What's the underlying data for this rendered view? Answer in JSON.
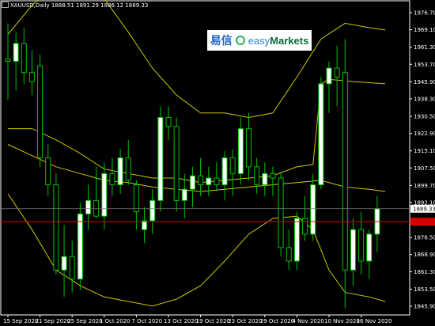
{
  "window": {
    "header_text": "XAUUSD,Daily  1888.51 1891.29 1886.12 1889.33"
  },
  "logo": {
    "cn_text": "易信",
    "en_text_a": "easy",
    "en_text_b": "Markets",
    "mark_icon": "easy-markets-swirl-icon"
  },
  "colors": {
    "background": "#000000",
    "bull_body": "#ffffff",
    "bear_body": "#000000",
    "candle_outline": "#00c000",
    "band": "#c8c800",
    "bid_line": "#ffffff",
    "ask_line": "#d40000"
  },
  "chart_data": {
    "type": "candlestick",
    "symbol": "XAUUSD",
    "timeframe": "Daily",
    "ohlc_header": {
      "open": 1888.51,
      "high": 1891.29,
      "low": 1886.12,
      "close": 1889.33
    },
    "y_range": [
      1842,
      1982
    ],
    "y_ticks": [
      "1976.70",
      "1969.10",
      "1961.30",
      "1953.70",
      "1945.90",
      "1938.30",
      "1930.50",
      "1922.90",
      "1915.10",
      "1907.50",
      "1899.70",
      "1892.10",
      "1876.50",
      "1868.90",
      "1861.30",
      "1853.50",
      "1845.90"
    ],
    "current_price_label": "1889.33",
    "current_price": 1889.33,
    "ask_price": 1883.6,
    "x_labels": [
      "15 Sep 2020",
      "21 Sep 2020",
      "25 Sep 2020",
      "1 Oct 2020",
      "7 Oct 2020",
      "13 Oct 2020",
      "19 Oct 2020",
      "23 Oct 2020",
      "29 Oct 2020",
      "4 Nov 2020",
      "10 Nov 2020",
      "16 Nov 2020"
    ],
    "x_label_bar_index": [
      0,
      4,
      8,
      12,
      16,
      20,
      24,
      28,
      32,
      36,
      40,
      44
    ],
    "candles": [
      {
        "o": 1956,
        "h": 1972,
        "l": 1938,
        "c": 1955
      },
      {
        "o": 1955,
        "h": 1968,
        "l": 1942,
        "c": 1963
      },
      {
        "o": 1963,
        "h": 1970,
        "l": 1945,
        "c": 1950
      },
      {
        "o": 1950,
        "h": 1960,
        "l": 1940,
        "c": 1946
      },
      {
        "o": 1953,
        "h": 1958,
        "l": 1908,
        "c": 1912
      },
      {
        "o": 1912,
        "h": 1918,
        "l": 1895,
        "c": 1900
      },
      {
        "o": 1900,
        "h": 1905,
        "l": 1860,
        "c": 1862
      },
      {
        "o": 1862,
        "h": 1882,
        "l": 1850,
        "c": 1868
      },
      {
        "o": 1868,
        "h": 1875,
        "l": 1852,
        "c": 1858
      },
      {
        "o": 1858,
        "h": 1892,
        "l": 1853,
        "c": 1887
      },
      {
        "o": 1887,
        "h": 1900,
        "l": 1880,
        "c": 1893
      },
      {
        "o": 1893,
        "h": 1908,
        "l": 1885,
        "c": 1886
      },
      {
        "o": 1886,
        "h": 1910,
        "l": 1880,
        "c": 1905
      },
      {
        "o": 1905,
        "h": 1912,
        "l": 1895,
        "c": 1900
      },
      {
        "o": 1900,
        "h": 1916,
        "l": 1896,
        "c": 1912
      },
      {
        "o": 1912,
        "h": 1920,
        "l": 1900,
        "c": 1902
      },
      {
        "o": 1900,
        "h": 1902,
        "l": 1880,
        "c": 1888
      },
      {
        "o": 1880,
        "h": 1890,
        "l": 1874,
        "c": 1884
      },
      {
        "o": 1884,
        "h": 1898,
        "l": 1878,
        "c": 1893
      },
      {
        "o": 1893,
        "h": 1935,
        "l": 1888,
        "c": 1930
      },
      {
        "o": 1930,
        "h": 1935,
        "l": 1920,
        "c": 1926
      },
      {
        "o": 1926,
        "h": 1930,
        "l": 1888,
        "c": 1893
      },
      {
        "o": 1893,
        "h": 1905,
        "l": 1885,
        "c": 1898
      },
      {
        "o": 1898,
        "h": 1908,
        "l": 1890,
        "c": 1904
      },
      {
        "o": 1904,
        "h": 1912,
        "l": 1895,
        "c": 1900
      },
      {
        "o": 1900,
        "h": 1908,
        "l": 1895,
        "c": 1903
      },
      {
        "o": 1903,
        "h": 1910,
        "l": 1897,
        "c": 1900
      },
      {
        "o": 1900,
        "h": 1915,
        "l": 1893,
        "c": 1912
      },
      {
        "o": 1912,
        "h": 1916,
        "l": 1895,
        "c": 1905
      },
      {
        "o": 1905,
        "h": 1930,
        "l": 1900,
        "c": 1925
      },
      {
        "o": 1925,
        "h": 1932,
        "l": 1902,
        "c": 1908
      },
      {
        "o": 1908,
        "h": 1912,
        "l": 1896,
        "c": 1900
      },
      {
        "o": 1900,
        "h": 1910,
        "l": 1895,
        "c": 1905
      },
      {
        "o": 1905,
        "h": 1908,
        "l": 1895,
        "c": 1903
      },
      {
        "o": 1903,
        "h": 1906,
        "l": 1868,
        "c": 1872
      },
      {
        "o": 1872,
        "h": 1880,
        "l": 1862,
        "c": 1866
      },
      {
        "o": 1866,
        "h": 1888,
        "l": 1862,
        "c": 1885
      },
      {
        "o": 1885,
        "h": 1895,
        "l": 1875,
        "c": 1878
      },
      {
        "o": 1878,
        "h": 1905,
        "l": 1875,
        "c": 1900
      },
      {
        "o": 1900,
        "h": 1948,
        "l": 1898,
        "c": 1945
      },
      {
        "o": 1945,
        "h": 1955,
        "l": 1932,
        "c": 1952
      },
      {
        "o": 1952,
        "h": 1962,
        "l": 1935,
        "c": 1948
      },
      {
        "o": 1950,
        "h": 1965,
        "l": 1845,
        "c": 1862
      },
      {
        "o": 1862,
        "h": 1885,
        "l": 1855,
        "c": 1880
      },
      {
        "o": 1880,
        "h": 1888,
        "l": 1860,
        "c": 1866
      },
      {
        "o": 1866,
        "h": 1880,
        "l": 1858,
        "c": 1878
      },
      {
        "o": 1878,
        "h": 1895,
        "l": 1870,
        "c": 1889.33
      }
    ],
    "bands": {
      "upper": [
        {
          "i": 0,
          "v": 1967
        },
        {
          "i": 3,
          "v": 1980
        },
        {
          "i": 6,
          "v": 1990
        },
        {
          "i": 9,
          "v": 1992
        },
        {
          "i": 12,
          "v": 1983
        },
        {
          "i": 15,
          "v": 1968
        },
        {
          "i": 18,
          "v": 1952
        },
        {
          "i": 21,
          "v": 1940
        },
        {
          "i": 24,
          "v": 1932
        },
        {
          "i": 27,
          "v": 1932
        },
        {
          "i": 30,
          "v": 1930
        },
        {
          "i": 33,
          "v": 1932
        },
        {
          "i": 36,
          "v": 1948
        },
        {
          "i": 39,
          "v": 1965
        },
        {
          "i": 42,
          "v": 1972
        },
        {
          "i": 45,
          "v": 1970
        },
        {
          "i": 47,
          "v": 1969
        }
      ],
      "middle": [
        {
          "i": 0,
          "v": 1925
        },
        {
          "i": 3,
          "v": 1925
        },
        {
          "i": 6,
          "v": 1920
        },
        {
          "i": 9,
          "v": 1914
        },
        {
          "i": 12,
          "v": 1907
        },
        {
          "i": 15,
          "v": 1905
        },
        {
          "i": 18,
          "v": 1903
        },
        {
          "i": 21,
          "v": 1903
        },
        {
          "i": 24,
          "v": 1901
        },
        {
          "i": 27,
          "v": 1902
        },
        {
          "i": 30,
          "v": 1903
        },
        {
          "i": 33,
          "v": 1904
        },
        {
          "i": 36,
          "v": 1908
        },
        {
          "i": 38,
          "v": 1909
        },
        {
          "i": 39,
          "v": 1945
        },
        {
          "i": 40,
          "v": 1947
        },
        {
          "i": 43,
          "v": 1946
        },
        {
          "i": 47,
          "v": 1945
        }
      ],
      "lower": [
        {
          "i": 0,
          "v": 1896
        },
        {
          "i": 3,
          "v": 1880
        },
        {
          "i": 6,
          "v": 1862
        },
        {
          "i": 9,
          "v": 1855
        },
        {
          "i": 12,
          "v": 1850
        },
        {
          "i": 15,
          "v": 1848
        },
        {
          "i": 18,
          "v": 1846
        },
        {
          "i": 21,
          "v": 1849
        },
        {
          "i": 24,
          "v": 1855
        },
        {
          "i": 27,
          "v": 1866
        },
        {
          "i": 30,
          "v": 1878
        },
        {
          "i": 33,
          "v": 1885
        },
        {
          "i": 36,
          "v": 1886
        },
        {
          "i": 38,
          "v": 1880
        },
        {
          "i": 40,
          "v": 1862
        },
        {
          "i": 42,
          "v": 1852
        },
        {
          "i": 45,
          "v": 1850
        },
        {
          "i": 47,
          "v": 1848
        }
      ],
      "lower_mid": [
        {
          "i": 0,
          "v": 1918
        },
        {
          "i": 3,
          "v": 1913
        },
        {
          "i": 6,
          "v": 1908
        },
        {
          "i": 9,
          "v": 1905
        },
        {
          "i": 12,
          "v": 1902
        },
        {
          "i": 15,
          "v": 1901
        },
        {
          "i": 18,
          "v": 1899
        },
        {
          "i": 21,
          "v": 1898
        },
        {
          "i": 24,
          "v": 1897
        },
        {
          "i": 27,
          "v": 1898
        },
        {
          "i": 30,
          "v": 1899
        },
        {
          "i": 33,
          "v": 1900
        },
        {
          "i": 36,
          "v": 1901
        },
        {
          "i": 39,
          "v": 1902
        },
        {
          "i": 42,
          "v": 1899
        },
        {
          "i": 45,
          "v": 1898
        },
        {
          "i": 47,
          "v": 1897
        }
      ]
    }
  }
}
